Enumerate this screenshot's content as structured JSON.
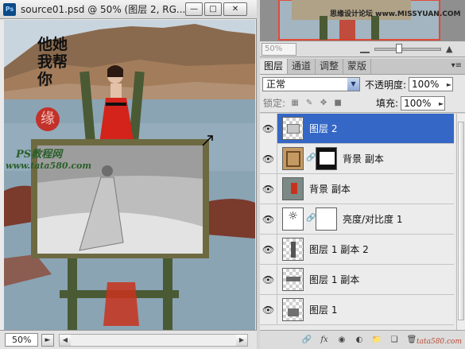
{
  "document": {
    "title": "source01.psd @ 50% (图层 2, RG...",
    "logo_text": "Ps",
    "zoom": "50%",
    "window_buttons": [
      "minimize",
      "restore",
      "close"
    ],
    "canvas_text": {
      "calligraphy": "他她我帮你",
      "seal": "缘",
      "watermark_line1": "PS教程网",
      "watermark_line2": "www.tata580.com"
    }
  },
  "navigator": {
    "zoom": "50%",
    "preview_text": "思缘设计论坛 www.MISSYUAN.COM"
  },
  "layers_panel": {
    "tabs": [
      "图层",
      "通道",
      "调整",
      "蒙版"
    ],
    "blend_mode": "正常",
    "opacity_label": "不透明度:",
    "opacity_value": "100%",
    "lock_label": "锁定:",
    "fill_label": "填充:",
    "fill_value": "100%",
    "layers": [
      {
        "name": "图层 2",
        "selected": true
      },
      {
        "name": "背景 副本",
        "selected": false
      },
      {
        "name": "背景 副本",
        "selected": false
      },
      {
        "name": "亮度/对比度 1",
        "selected": false
      },
      {
        "name": "图层 1 副本 2",
        "selected": false
      },
      {
        "name": "图层 1 副本",
        "selected": false
      },
      {
        "name": "图层 1",
        "selected": false
      }
    ],
    "footer_watermark": "tata580.com"
  },
  "colors": {
    "selection": "#3567c6",
    "dress": "#d4231a",
    "easel": "#3a4a2a"
  }
}
